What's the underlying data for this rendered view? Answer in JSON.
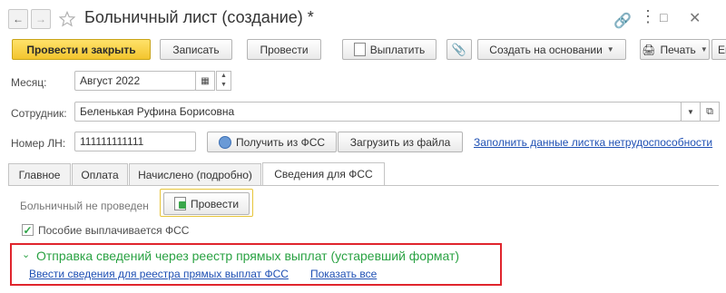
{
  "header": {
    "title": "Больничный лист (создание) *"
  },
  "toolbar": {
    "post_close": "Провести и закрыть",
    "save": "Записать",
    "post": "Провести",
    "pay": "Выплатить",
    "create_based": "Создать на основании",
    "print": "Печать",
    "more": "Еще"
  },
  "form": {
    "month_label": "Месяц:",
    "month_value": "Август 2022",
    "employee_label": "Сотрудник:",
    "employee_value": "Беленькая Руфина Борисовна",
    "ln_label": "Номер ЛН:",
    "ln_value": "111111111111",
    "get_fss": "Получить из ФСС",
    "load_file": "Загрузить из файла",
    "fill_link": "Заполнить данные листка нетрудоспособности"
  },
  "tabs": [
    {
      "label": "Главное"
    },
    {
      "label": "Оплата"
    },
    {
      "label": "Начислено (подробно)"
    },
    {
      "label": "Сведения для ФСС"
    }
  ],
  "fss": {
    "status_text": "Больничный не проведен",
    "post_button": "Провести",
    "benefit_checkbox_label": "Пособие выплачивается ФСС",
    "benefit_checked": true,
    "group_title": "Отправка сведений через реестр прямых выплат (устаревший формат)",
    "link_enter": "Ввести сведения для реестра прямых выплат ФСС",
    "link_show_all": "Показать все"
  },
  "colors": {
    "accent_yellow": "#f3c52e",
    "group_green": "#2aa243",
    "highlight_red": "#e0252d",
    "link_blue": "#1f50b4"
  }
}
